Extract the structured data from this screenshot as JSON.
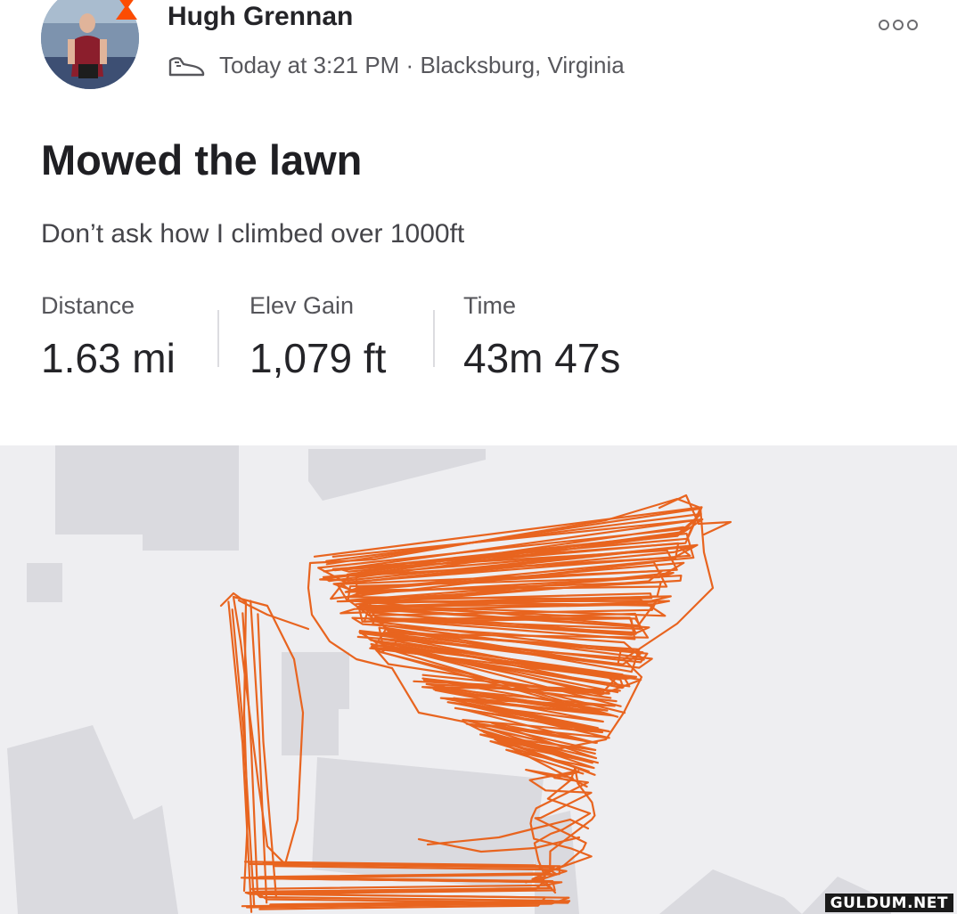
{
  "activity": {
    "athlete_name": "Hugh Grennan",
    "meta": "Today at 3:21 PM · Blacksburg, Virginia",
    "activity_type_icon": "shoe-icon",
    "title": "Mowed the lawn",
    "description": "Don’t ask how I climbed over 1000ft"
  },
  "stats": [
    {
      "label": "Distance",
      "value": "1.63 mi"
    },
    {
      "label": "Elev Gain",
      "value": "1,079 ft"
    },
    {
      "label": "Time",
      "value": "43m 47s"
    }
  ],
  "map": {
    "route_color": "#e8641f",
    "building_color": "#dadadf",
    "background_color": "#eeeef1"
  },
  "watermark": "GULDUM.NET",
  "colors": {
    "text_primary": "#242428",
    "text_secondary": "#57575c",
    "accent": "#fc4c02"
  }
}
